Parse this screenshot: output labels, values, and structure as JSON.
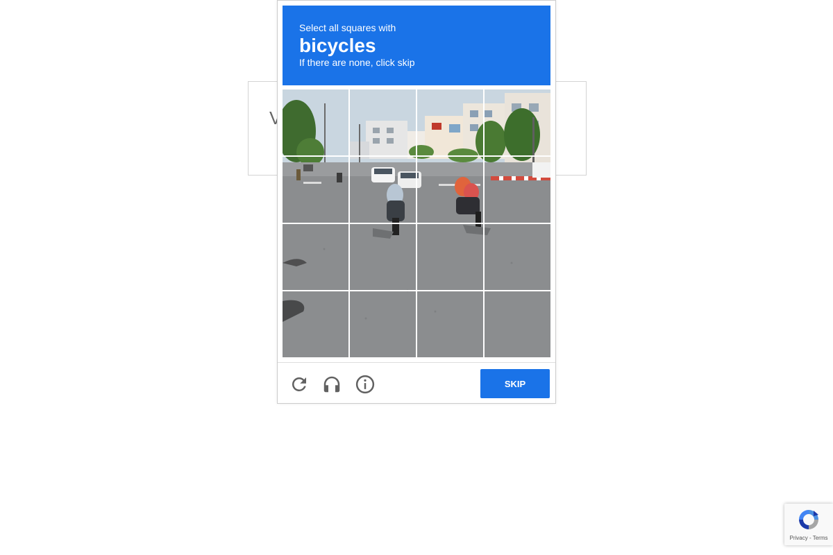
{
  "background": {
    "text_left": "V",
    "text_right": "..."
  },
  "challenge": {
    "header": {
      "line1": "Select all squares with",
      "target": "bicycles",
      "line3": "If there are none, click skip"
    },
    "grid": {
      "rows": 4,
      "cols": 4,
      "selected": []
    },
    "footer": {
      "reload_icon": "reload-icon",
      "audio_icon": "headphones-icon",
      "info_icon": "info-icon",
      "skip_label": "SKIP"
    },
    "colors": {
      "header_bg": "#1a73e8",
      "button_bg": "#1a73e8"
    }
  },
  "badge": {
    "privacy": "Privacy",
    "separator": " - ",
    "terms": "Terms"
  }
}
